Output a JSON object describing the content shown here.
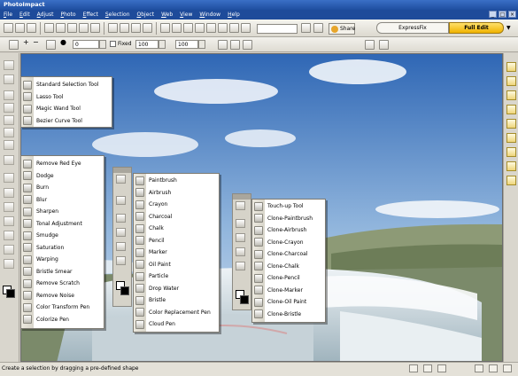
{
  "window": {
    "title": "PhotoImpact",
    "buttons": [
      "_",
      "□",
      "×"
    ]
  },
  "menu": [
    "File",
    "Edit",
    "Adjust",
    "Photo",
    "Effect",
    "Selection",
    "Object",
    "Web",
    "View",
    "Window",
    "Help"
  ],
  "toolbar": {
    "share_label": "Share",
    "express_fix": "ExpressFix",
    "full_edit": "Full Edit",
    "zoom_value": ""
  },
  "options": {
    "value1": "0",
    "fixed_label": "Fixed",
    "width": "100",
    "height": "100"
  },
  "flyouts": {
    "selection": [
      "Standard Selection Tool",
      "Lasso Tool",
      "Magic Wand Tool",
      "Bezier Curve Tool"
    ],
    "retouch": [
      "Remove Red Eye",
      "Dodge",
      "Burn",
      "Blur",
      "Sharpen",
      "Tonal Adjustment",
      "Smudge",
      "Saturation",
      "Warping",
      "Bristle Smear",
      "Remove Scratch",
      "Remove Noise",
      "Color Transform Pen",
      "Colorize Pen"
    ],
    "paint": [
      "Paintbrush",
      "Airbrush",
      "Crayon",
      "Charcoal",
      "Chalk",
      "Pencil",
      "Marker",
      "Oil Paint",
      "Particle",
      "Drop Water",
      "Bristle",
      "Color Replacement Pen",
      "Cloud Pen"
    ],
    "clone": [
      "Touch-up Tool",
      "Clone-Paintbrush",
      "Clone-Airbrush",
      "Clone-Crayon",
      "Clone-Charcoal",
      "Clone-Chalk",
      "Clone-Pencil",
      "Clone-Marker",
      "Clone-Oil Paint",
      "Clone-Bristle"
    ]
  },
  "status": {
    "text": "Create a selection by dragging a pre-defined shape"
  },
  "colors": {
    "accent_gold": "#f0b300",
    "title_blue": "#1f4ea0"
  }
}
